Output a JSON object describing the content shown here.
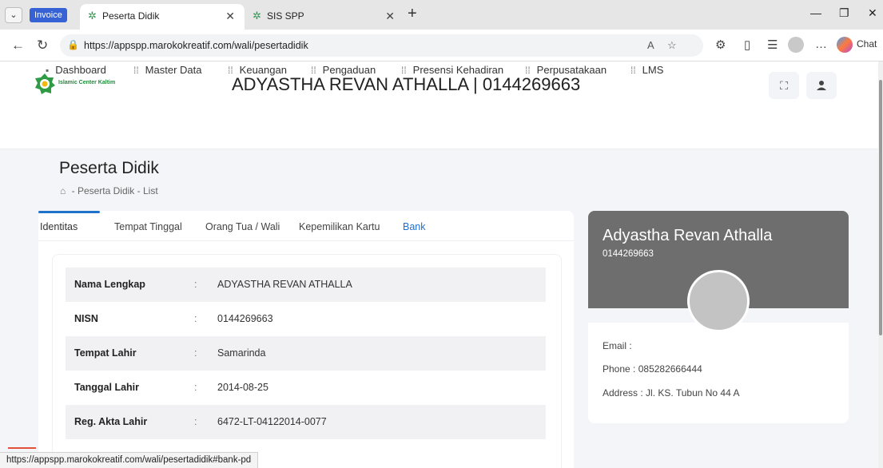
{
  "browser": {
    "tab_group_label": "Invoice",
    "tabs": [
      {
        "title": "Peserta Didik"
      },
      {
        "title": "SIS SPP"
      }
    ],
    "url": "https://appspp.marokokreatif.com/wali/pesertadidik",
    "copilot_label": "Chat",
    "status_url": "https://appspp.marokokreatif.com/wali/pesertadidik#bank-pd"
  },
  "header": {
    "logo_text": "Islamic Center Kaltim",
    "title": "ADYASTHA REVAN ATHALLA | 0144269663"
  },
  "menu": [
    {
      "label": "Dashboard"
    },
    {
      "label": "Master Data"
    },
    {
      "label": "Keuangan"
    },
    {
      "label": "Pengaduan"
    },
    {
      "label": "Presensi Kehadiran"
    },
    {
      "label": "Perpusatakaan"
    },
    {
      "label": "LMS"
    }
  ],
  "page": {
    "title": "Peserta Didik",
    "breadcrumb": [
      "Peserta Didik",
      "List"
    ]
  },
  "tabs": [
    {
      "label": "Identitas"
    },
    {
      "label": "Tempat Tinggal"
    },
    {
      "label": "Orang Tua / Wali"
    },
    {
      "label": "Kepemilikan Kartu"
    },
    {
      "label": "Bank"
    }
  ],
  "identity_rows": [
    {
      "label": "Nama Lengkap",
      "value": "ADYASTHA REVAN ATHALLA"
    },
    {
      "label": "NISN",
      "value": "0144269663"
    },
    {
      "label": "Tempat Lahir",
      "value": "Samarinda"
    },
    {
      "label": "Tanggal Lahir",
      "value": "2014-08-25"
    },
    {
      "label": "Reg. Akta Lahir",
      "value": "6472-LT-04122014-0077"
    }
  ],
  "profile": {
    "name": "Adyastha Revan Athalla",
    "nisn": "0144269663",
    "email_label": "Email :",
    "email_value": "",
    "phone_label": "Phone :",
    "phone_value": "085282666444",
    "address_label": "Address :",
    "address_value": "Jl. KS. Tubun No 44 A"
  },
  "colors": {
    "accent": "#1e73c8",
    "profile_header": "#6e6e6e",
    "brand_green": "#1f8a3b"
  }
}
